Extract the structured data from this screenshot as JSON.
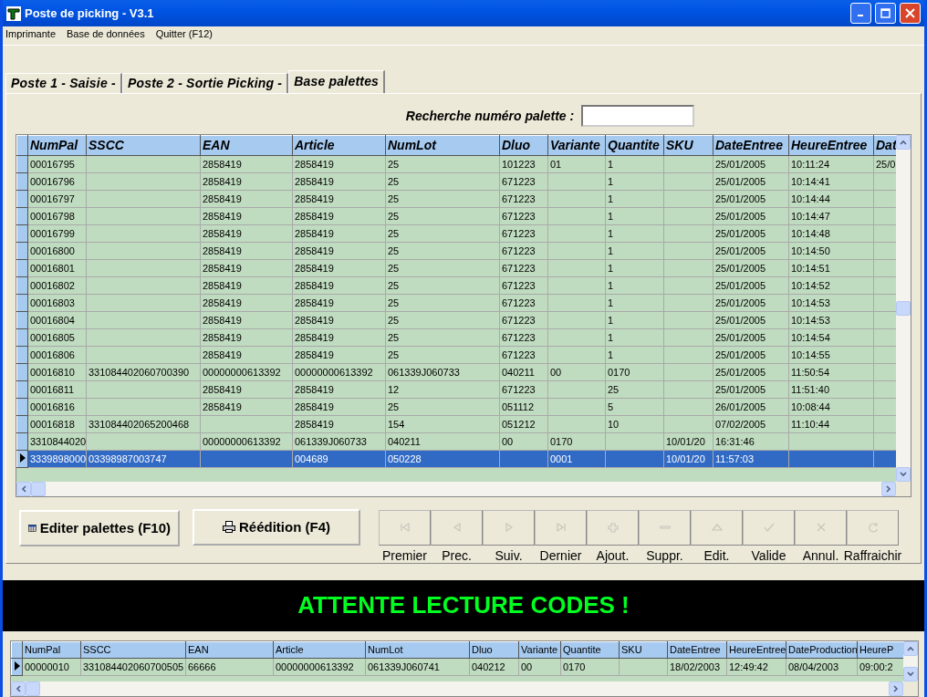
{
  "window": {
    "title": "Poste de picking - V3.1"
  },
  "menu": [
    "Imprimante",
    "Base de données",
    "Quitter (F12)"
  ],
  "tabs": [
    {
      "label": "Poste 1 - Saisie -",
      "selected": false
    },
    {
      "label": "Poste 2 - Sortie Picking -",
      "selected": false
    },
    {
      "label": "Base palettes",
      "selected": true
    }
  ],
  "search": {
    "label": "Recherche numéro palette :"
  },
  "table": {
    "columns": [
      "NumPal",
      "SSCC",
      "EAN",
      "Article",
      "NumLot",
      "Dluo",
      "Variante",
      "Quantite",
      "SKU",
      "DateEntree",
      "HeureEntree",
      "Dat"
    ],
    "rows": [
      {
        "selected": false,
        "cells": [
          "00016795",
          null,
          "2858419",
          "2858419",
          "25",
          "101223",
          "01",
          "1",
          null,
          "25/01/2005",
          "10:11:24",
          "25/0"
        ]
      },
      {
        "selected": false,
        "cells": [
          "00016796",
          null,
          "2858419",
          "2858419",
          "25",
          "671223",
          null,
          "1",
          null,
          "25/01/2005",
          "10:14:41",
          null
        ]
      },
      {
        "selected": false,
        "cells": [
          "00016797",
          null,
          "2858419",
          "2858419",
          "25",
          "671223",
          null,
          "1",
          null,
          "25/01/2005",
          "10:14:44",
          null
        ]
      },
      {
        "selected": false,
        "cells": [
          "00016798",
          null,
          "2858419",
          "2858419",
          "25",
          "671223",
          null,
          "1",
          null,
          "25/01/2005",
          "10:14:47",
          null
        ]
      },
      {
        "selected": false,
        "cells": [
          "00016799",
          null,
          "2858419",
          "2858419",
          "25",
          "671223",
          null,
          "1",
          null,
          "25/01/2005",
          "10:14:48",
          null
        ]
      },
      {
        "selected": false,
        "cells": [
          "00016800",
          null,
          "2858419",
          "2858419",
          "25",
          "671223",
          null,
          "1",
          null,
          "25/01/2005",
          "10:14:50",
          null
        ]
      },
      {
        "selected": false,
        "cells": [
          "00016801",
          null,
          "2858419",
          "2858419",
          "25",
          "671223",
          null,
          "1",
          null,
          "25/01/2005",
          "10:14:51",
          null
        ]
      },
      {
        "selected": false,
        "cells": [
          "00016802",
          null,
          "2858419",
          "2858419",
          "25",
          "671223",
          null,
          "1",
          null,
          "25/01/2005",
          "10:14:52",
          null
        ]
      },
      {
        "selected": false,
        "cells": [
          "00016803",
          null,
          "2858419",
          "2858419",
          "25",
          "671223",
          null,
          "1",
          null,
          "25/01/2005",
          "10:14:53",
          null
        ]
      },
      {
        "selected": false,
        "cells": [
          "00016804",
          null,
          "2858419",
          "2858419",
          "25",
          "671223",
          null,
          "1",
          null,
          "25/01/2005",
          "10:14:53",
          null
        ]
      },
      {
        "selected": false,
        "cells": [
          "00016805",
          null,
          "2858419",
          "2858419",
          "25",
          "671223",
          null,
          "1",
          null,
          "25/01/2005",
          "10:14:54",
          null
        ]
      },
      {
        "selected": false,
        "cells": [
          "00016806",
          null,
          "2858419",
          "2858419",
          "25",
          "671223",
          null,
          "1",
          null,
          "25/01/2005",
          "10:14:55",
          null
        ]
      },
      {
        "selected": false,
        "cells": [
          "00016810",
          "331084402060700390",
          "00000000613392",
          "00000000613392",
          "061339J060733",
          "040211",
          "00",
          "0170",
          null,
          "25/01/2005",
          "11:50:54",
          null
        ]
      },
      {
        "selected": false,
        "cells": [
          "00016811",
          null,
          "2858419",
          "2858419",
          "12",
          "671223",
          null,
          "25",
          null,
          "25/01/2005",
          "11:51:40",
          null
        ]
      },
      {
        "selected": false,
        "cells": [
          "00016816",
          null,
          "2858419",
          "2858419",
          "25",
          "051112",
          null,
          "5",
          null,
          "26/01/2005",
          "10:08:44",
          null
        ]
      },
      {
        "selected": false,
        "cells": [
          "00016818",
          "331084402065200468",
          null,
          "2858419",
          "154",
          "051212",
          null,
          "10",
          null,
          "07/02/2005",
          "11:10:44",
          null
        ]
      },
      {
        "selected": false,
        "cells": [
          "3310844020",
          null,
          "00000000613392",
          "061339J060733",
          "040211",
          "00",
          "0170",
          null,
          "10/01/20",
          "16:31:46",
          null,
          null
        ]
      },
      {
        "selected": true,
        "cells": [
          "3339898000",
          "03398987003747",
          null,
          "004689",
          "050228",
          null,
          "0001",
          null,
          "10/01/20",
          "11:57:03",
          null,
          null
        ]
      }
    ]
  },
  "buttons": [
    {
      "label": "Editer palettes (F10)"
    },
    {
      "label": "Réédition (F4)"
    }
  ],
  "navigator": [
    {
      "label": "Premier",
      "disabled": true
    },
    {
      "label": "Prec.",
      "disabled": true
    },
    {
      "label": "Suiv.",
      "disabled": true
    },
    {
      "label": "Dernier",
      "disabled": true
    },
    {
      "label": "Ajout.",
      "disabled": true
    },
    {
      "label": "Suppr.",
      "disabled": true
    },
    {
      "label": "Edit.",
      "disabled": true
    },
    {
      "label": "Valide",
      "disabled": true
    },
    {
      "label": "Annul.",
      "disabled": true
    },
    {
      "label": "Raffraichir",
      "disabled": true
    }
  ],
  "status_banner": "ATTENTE LECTURE CODES !",
  "bottom_table": {
    "columns": [
      "NumPal",
      "SSCC",
      "EAN",
      "Article",
      "NumLot",
      "Dluo",
      "Variante",
      "Quantite",
      "SKU",
      "DateEntree",
      "HeureEntree",
      "DateProduction",
      "HeureP"
    ],
    "rows": [
      {
        "selected": true,
        "cells": [
          "00000010",
          "331084402060700505",
          "66666",
          "00000000613392",
          "061339J060741",
          "040212",
          "00",
          "0170",
          null,
          "18/02/2003",
          "12:49:42",
          "08/04/2003",
          "09:00:2"
        ]
      }
    ]
  }
}
